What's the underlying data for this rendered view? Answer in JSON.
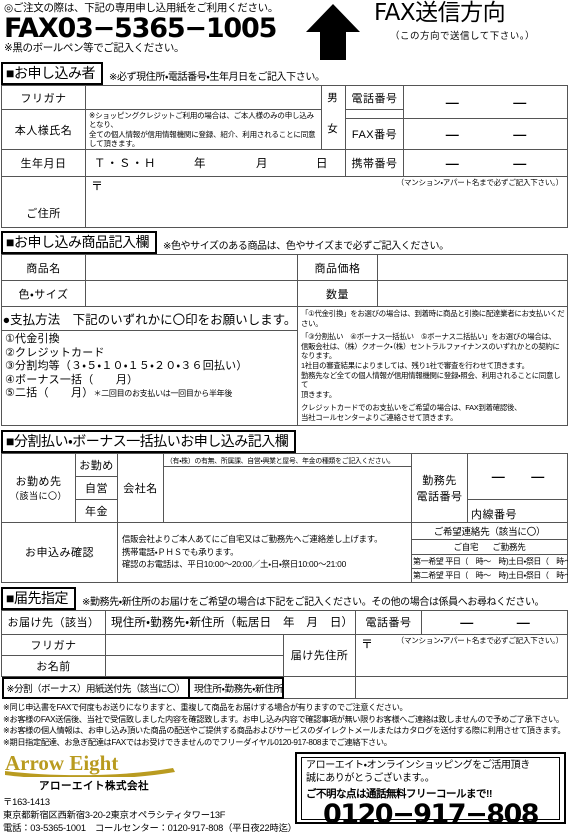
{
  "header": {
    "order_note": "◎ご注文の際は、下記の専用申し込用紙をご利用ください。",
    "fax_number": "FAX03−5365−1005",
    "pen_note": "※黒のボールペン等でご記入ください。",
    "fax_direction_title": "FAX送信方向",
    "fax_direction_sub": "（この方向で送信して下さい。）"
  },
  "applicant": {
    "chip": "■お申し込み者",
    "note": "※必ず現住所・電話番号・生年月日をご記入下さい。",
    "furigana_label": "フリガナ",
    "name_label": "本人様氏名",
    "name_note_line1": "※ショッピングクレジットご利用の場合は、ご本人様のみの申し込みとなり、",
    "name_note_line2": "全ての個人情報が信用情報機関に登録、紹介、利用されることに同意して頂きます。",
    "gender_male": "男",
    "gender_female": "女",
    "dob_label": "生年月日",
    "dob_era": "Ｔ・Ｓ・Ｈ",
    "dob_year": "年",
    "dob_month": "月",
    "dob_day": "日",
    "address_label": "ご住所",
    "postal_mark": "〒",
    "address_note": "（マンション・アパート名まで必ずご記入下さい。）",
    "tel_label": "電話番号",
    "fax_label": "FAX番号",
    "mobile_label": "携帯番号",
    "dash": "—"
  },
  "product": {
    "chip": "■お申し込み商品記入欄",
    "note": "※色やサイズのある商品は、色やサイズまで必ずご記入ください。",
    "name_label": "商品名",
    "price_label": "商品価格",
    "color_size_label": "色・サイズ",
    "qty_label": "数量",
    "pay_head": "●支払方法　下記のいずれかに〇印をお願いします。",
    "pay_options": [
      "①代金引換",
      "②クレジットカード",
      "③分割均等（３・５・１０・１５・２０・３６回払い）",
      "④ボーナス一括（　　月）"
    ],
    "pay_option5_main": "⑤二括（　　月）",
    "pay_option5_sub": "＊二回目のお支払いは一回目から半年後",
    "pay_fine": [
      "「①代金引換」をお選びの場合は、到着時に商品と引換に配達業者にお支払いください。",
      "「③分割払い　④ボーナス一括払い　⑤ボーナス二括払い」をお選びの場合は、",
      "信販会社は、（株）クオーク・（株）セントラルファイナンスのいずれかとの契約になります。",
      "1社目の審査結果によりましては、残り1社で審査を行わせて頂きます。",
      "勤務先など全ての個人情報が信用情報機関に登録・照会、利用されることに同意して",
      "頂きます。",
      "クレジットカードでのお支払いをご希望の場合は、FAX到着確認後、",
      "当社コールセンターよりご連絡させて頂きます。"
    ]
  },
  "installment": {
    "chip": "■分割払い・ボーナス一括払いお申し込み記入欄",
    "work_label": "お勤め先",
    "work_sub": "（該当に〇）",
    "work_types": [
      "お勤め",
      "自営",
      "年金"
    ],
    "company_label": "会社名",
    "company_note": "（有・株）の有無、所属課、自営・興業と屋号、年金の種類をご記入ください。",
    "work_tel_label_l1": "勤務先",
    "work_tel_label_l2": "電話番号",
    "ext_label": "内線番号",
    "dash": "—",
    "confirm_label": "お申込み確認",
    "confirm_lines": [
      "信販会社よりご本人あてにご自宅又はご勤務先へご連絡差し上げます。",
      "携帯電話・ＰＨＳでも承ります。",
      "確認のお電話は、平日10:00〜20:00／土・日・祭日10:00〜21:00"
    ],
    "wish_head": "ご希望連絡先（該当に〇）",
    "wish_home": "ご自宅",
    "wish_work": "ご勤務先",
    "wish_rows": [
      {
        "rank": "第一希望",
        "text": "平日（　時〜　時)土日・祭日（　時〜　時)"
      },
      {
        "rank": "第二希望",
        "text": "平日（　時〜　時)土日・祭日（　時〜　時)"
      }
    ]
  },
  "delivery": {
    "chip": "■届先指定",
    "note": "※勤務先・新住所のお届けをご希望の場合は下記をご記入ください。その他の場合は係員へお尋ねください。",
    "dest_label": "お届け先（該当）",
    "dest_options": "現住所・勤務先・新住所（転居日　年　月　日）",
    "tel_label": "電話番号",
    "dash": "—",
    "furigana_label": "フリガナ",
    "name_label": "お名前",
    "address_label": "届け先住所",
    "postal_mark": "〒",
    "address_note": "（マンション・アパート名まで必ずご記入下さい。）",
    "send_to_left": "※分割（ボーナス）用紙送付先（該当に〇）",
    "send_to_right": "現住所・勤務先・新住所"
  },
  "footer_notes": [
    "※同じ申込書をFAXで何度もお送りになりますと、重複して商品をお届けする場合が有りますのでご注意ください。",
    "※お客様のFAX送信後、当社で受信致しました内容を確認致します。お申し込み内容で確認事項が無い限りお客様へご連絡は致しませんので予めご了承下さい。",
    "※お客様の個人情報は、お申し込み頂いた商品の配送やご提供する商品およびサービスのダイレクトメールまたはカタログを送付する際に利用させて頂きます。",
    "※期日指定配達、お急ぎ配達はFAXではお受けできませんのでフリーダイヤル0120-917-808までご連絡下さい。"
  ],
  "brand": {
    "logo_text": "Arrow Eight",
    "company_jp": "アローエイト株式会社",
    "postal": "〒163-1413",
    "address": "東京都新宿区西新宿3-20-2東京オペラシティタワー13F",
    "contact": "電話：03-5365-1001　コールセンター：0120-917-808（平日夜22時迄）"
  },
  "callout": {
    "line1": "アローエイト・オンラインショッピングをご活用頂き",
    "line2": "誠にありがとうございます。。",
    "line3": "ご不明な点は通話無料フリーコールまで!!",
    "tel": "0120−917−808"
  },
  "colors": {
    "ink": "#000000",
    "rule": "#555555",
    "logo_gold": "#b99b20",
    "paper": "#ffffff"
  }
}
